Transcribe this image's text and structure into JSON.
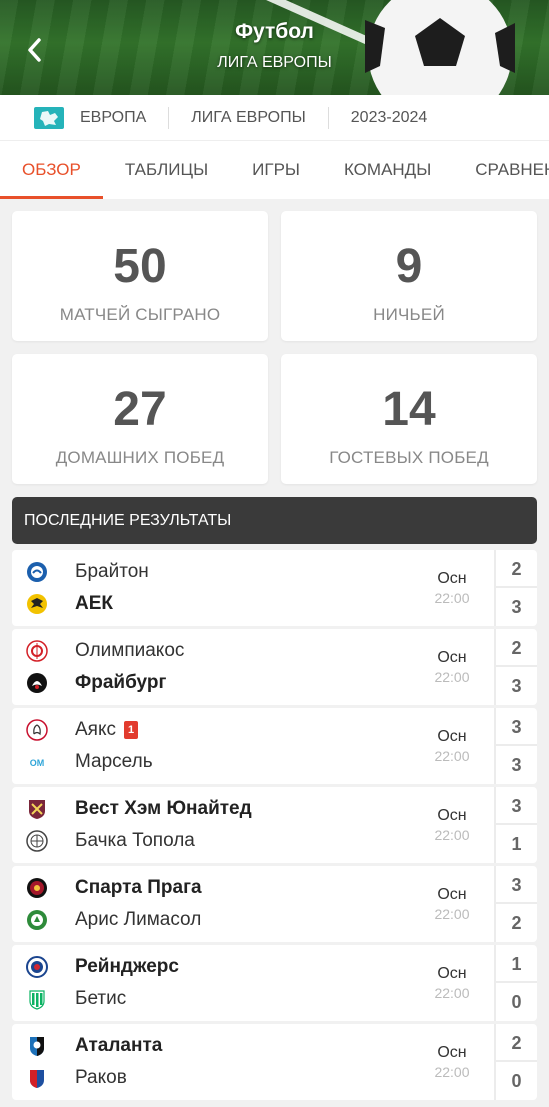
{
  "header": {
    "title": "Футбол",
    "subtitle": "ЛИГА ЕВРОПЫ",
    "back_icon": "chevron-left-icon"
  },
  "breadcrumb": {
    "flag_color": "#25b3b9",
    "region": "ЕВРОПА",
    "competition": "ЛИГА ЕВРОПЫ",
    "season": "2023-2024"
  },
  "tabs": [
    {
      "label": "ОБЗОР",
      "active": true
    },
    {
      "label": "ТАБЛИЦЫ",
      "active": false
    },
    {
      "label": "ИГРЫ",
      "active": false
    },
    {
      "label": "КОМАНДЫ",
      "active": false
    },
    {
      "label": "СРАВНЕНИЕ",
      "active": false
    }
  ],
  "stats": [
    {
      "value": "50",
      "label": "МАТЧЕЙ СЫГРАНО"
    },
    {
      "value": "9",
      "label": "НИЧЬЕЙ"
    },
    {
      "value": "27",
      "label": "ДОМАШНИХ ПОБЕД"
    },
    {
      "value": "14",
      "label": "ГОСТЕВЫХ ПОБЕД"
    }
  ],
  "results_title": "ПОСЛЕДНИЕ РЕЗУЛЬТАТЫ",
  "accent_color": "#e8502a",
  "matches": [
    {
      "home": "Брайтон",
      "away": "АЕК",
      "home_score": "2",
      "away_score": "3",
      "status": "Осн",
      "time": "22:00",
      "winner": "away",
      "home_logo": "brighton-logo-icon",
      "away_logo": "aek-logo-icon"
    },
    {
      "home": "Олимпиакос",
      "away": "Фрайбург",
      "home_score": "2",
      "away_score": "3",
      "status": "Осн",
      "time": "22:00",
      "winner": "away",
      "home_logo": "olympiacos-logo-icon",
      "away_logo": "freiburg-logo-icon"
    },
    {
      "home": "Аякс",
      "away": "Марсель",
      "home_score": "3",
      "away_score": "3",
      "status": "Осн",
      "time": "22:00",
      "winner": "none",
      "home_red_cards": "1",
      "home_logo": "ajax-logo-icon",
      "away_logo": "marseille-logo-icon"
    },
    {
      "home": "Вест Хэм Юнайтед",
      "away": "Бачка Топола",
      "home_score": "3",
      "away_score": "1",
      "status": "Осн",
      "time": "22:00",
      "winner": "home",
      "home_logo": "west-ham-logo-icon",
      "away_logo": "backa-topola-logo-icon"
    },
    {
      "home": "Спарта Прага",
      "away": "Арис Лимасол",
      "home_score": "3",
      "away_score": "2",
      "status": "Осн",
      "time": "22:00",
      "winner": "home",
      "home_logo": "sparta-prague-logo-icon",
      "away_logo": "aris-limassol-logo-icon"
    },
    {
      "home": "Рейнджерс",
      "away": "Бетис",
      "home_score": "1",
      "away_score": "0",
      "status": "Осн",
      "time": "22:00",
      "winner": "home",
      "home_logo": "rangers-logo-icon",
      "away_logo": "betis-logo-icon"
    },
    {
      "home": "Аталанта",
      "away": "Раков",
      "home_score": "2",
      "away_score": "0",
      "status": "Осн",
      "time": "22:00",
      "winner": "home",
      "home_logo": "atalanta-logo-icon",
      "away_logo": "rakow-logo-icon"
    }
  ]
}
